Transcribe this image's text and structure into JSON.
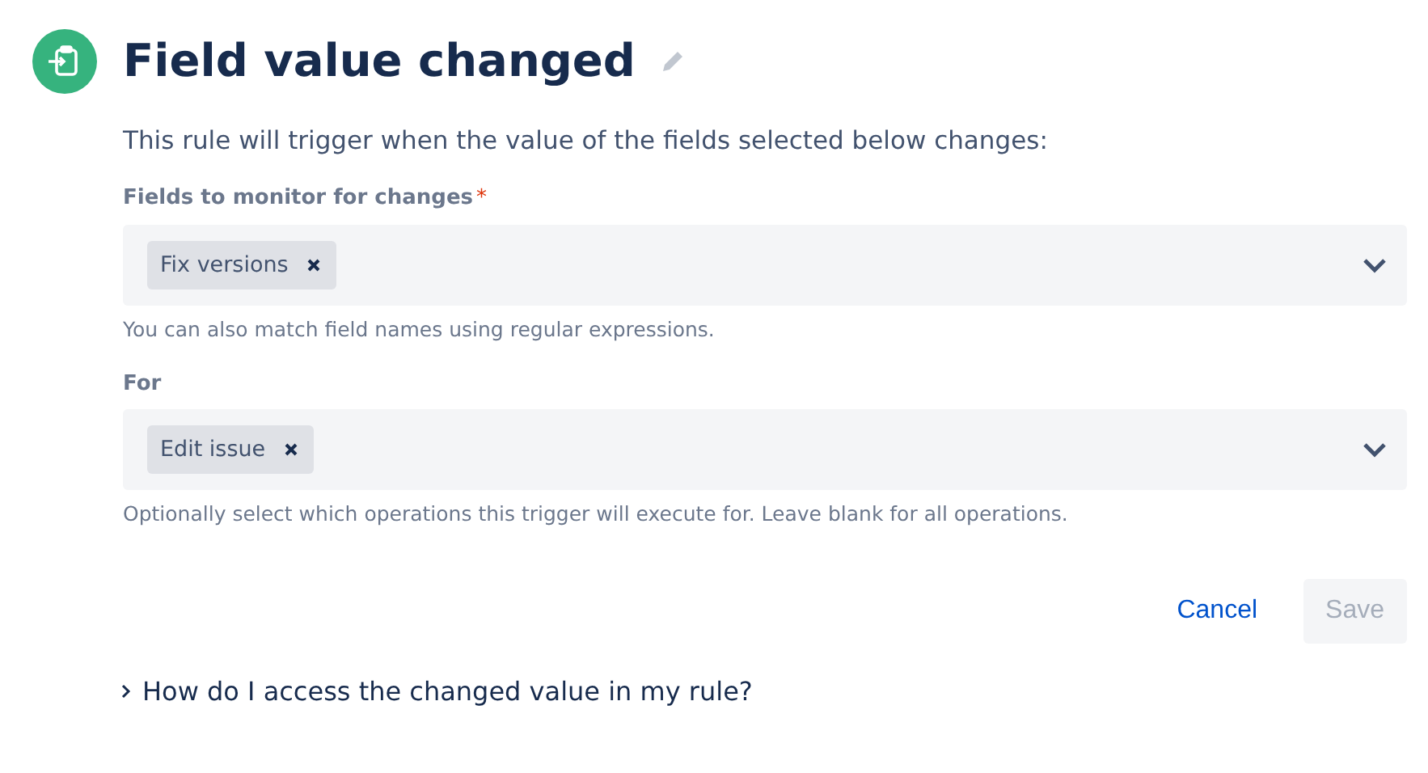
{
  "header": {
    "title": "Field value changed"
  },
  "description": "This rule will trigger when the value of the fields selected below changes:",
  "fields": [
    {
      "label": "Fields to monitor for changes",
      "required_mark": "*",
      "tags": [
        "Fix versions"
      ],
      "help": "You can also match field names using regular expressions."
    },
    {
      "label": "For",
      "tags": [
        "Edit issue"
      ],
      "help": "Optionally select which operations this trigger will execute for. Leave blank for all operations."
    }
  ],
  "buttons": [
    {
      "label": "Cancel",
      "kind": "link",
      "disabled": false
    },
    {
      "label": "Save",
      "kind": "primary",
      "disabled": true
    }
  ],
  "expander": {
    "label": "How do I access the changed value in my rule?",
    "expanded": false
  }
}
